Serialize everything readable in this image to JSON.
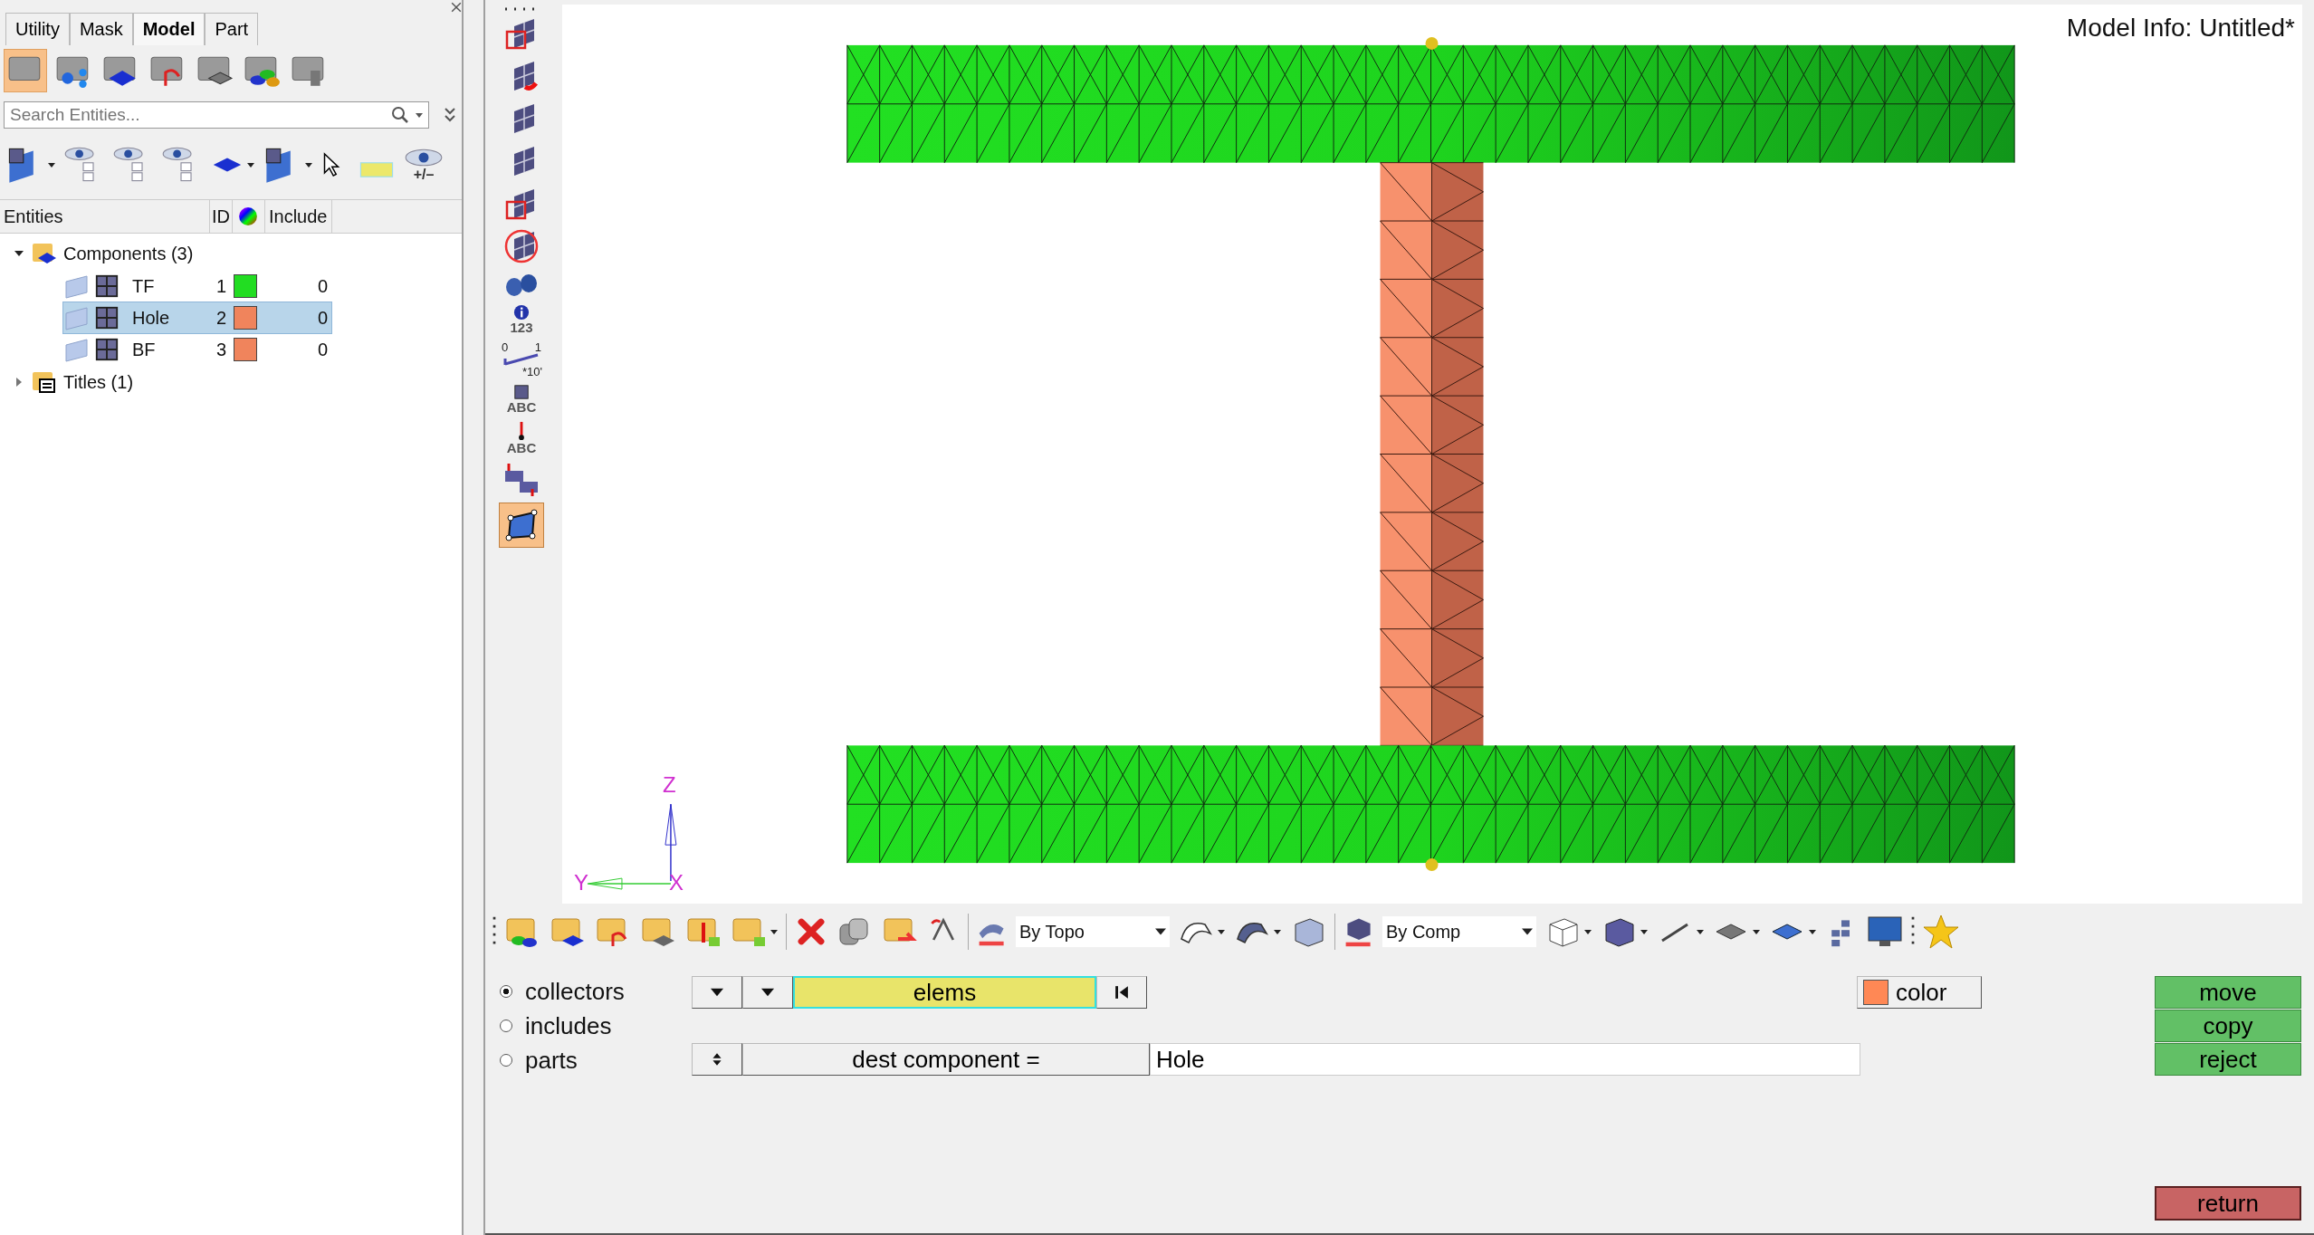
{
  "tabs": [
    {
      "label": "Utility",
      "selected": false
    },
    {
      "label": "Mask",
      "selected": false
    },
    {
      "label": "Model",
      "selected": true
    },
    {
      "label": "Part",
      "selected": false
    }
  ],
  "search": {
    "placeholder": "Search Entities..."
  },
  "show_hide_caption": "+/–",
  "entity_tree": {
    "columns": [
      "Entities",
      "ID",
      "Include"
    ],
    "items": [
      {
        "kind": "components",
        "label": "Components (3)",
        "expanded": true,
        "children": [
          {
            "name": "TF",
            "id": "1",
            "color": "#22dd22",
            "include": "0",
            "selected": false
          },
          {
            "name": "Hole",
            "id": "2",
            "color": "#f0845c",
            "include": "0",
            "selected": true
          },
          {
            "name": "BF",
            "id": "3",
            "color": "#f0845c",
            "include": "0",
            "selected": false
          }
        ]
      },
      {
        "kind": "titles",
        "label": "Titles (1)",
        "expanded": false
      }
    ]
  },
  "vertical_toolbar": {
    "captions": [
      "123",
      "ABC",
      "ABC"
    ],
    "scale_labels": [
      "0",
      "1",
      "*10'"
    ]
  },
  "viewport": {
    "model_info": "Model Info: Untitled*",
    "axes": {
      "z": "Z",
      "y": "Y",
      "x": "X"
    }
  },
  "toolbar": {
    "topo_mode": "By Topo",
    "comp_mode": "By Comp"
  },
  "panel": {
    "radios": [
      {
        "label": "collectors",
        "selected": true
      },
      {
        "label": "includes",
        "selected": false
      },
      {
        "label": "parts",
        "selected": false
      }
    ],
    "entity_selector": "elems",
    "dest_label": "dest component =",
    "dest_value": "Hole",
    "color_button": {
      "label": "color",
      "color": "#ff8855"
    },
    "actions": [
      "move",
      "copy",
      "reject"
    ],
    "return": "return"
  }
}
